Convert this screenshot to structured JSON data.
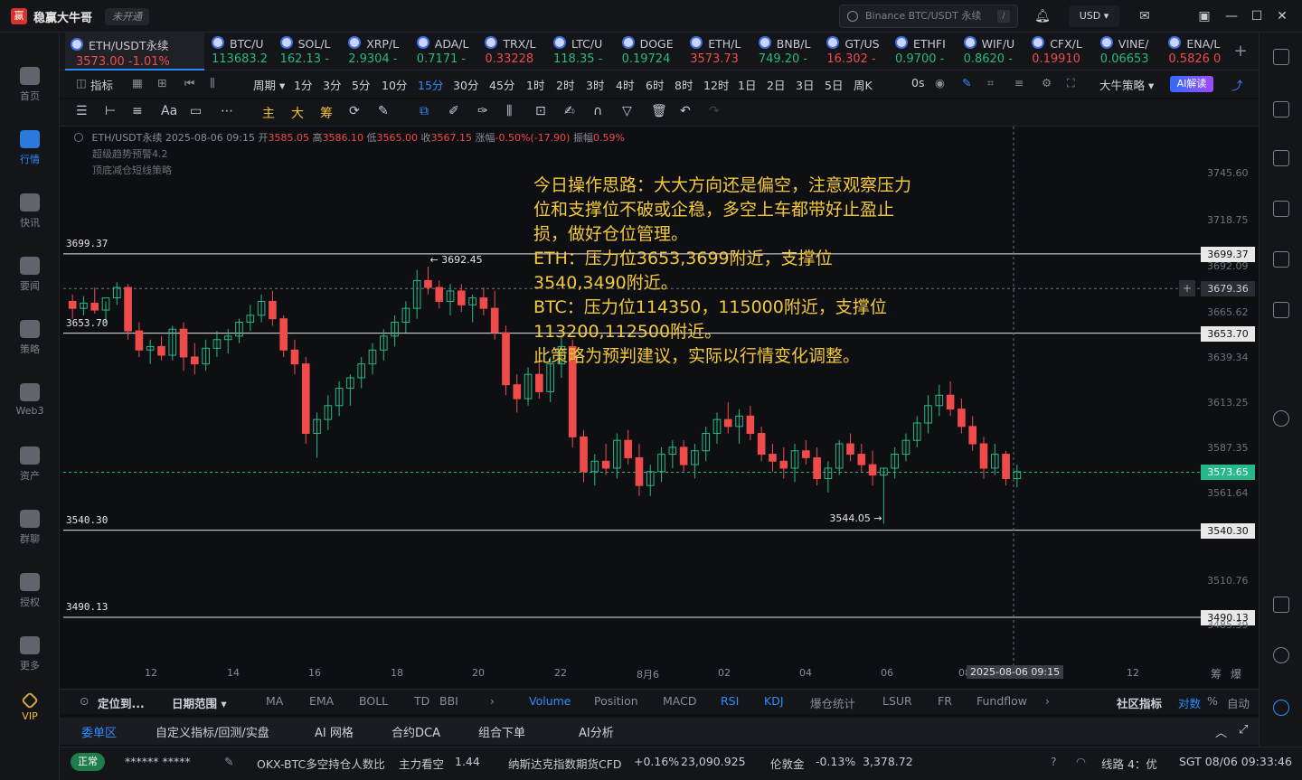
{
  "app": {
    "name": "稳赢大牛哥",
    "logo": "赢",
    "status": "未开通"
  },
  "search": {
    "placeholder": "Binance BTC/USDT 永续",
    "shortcut": "/"
  },
  "currency": "USD ▾",
  "sidebar": [
    {
      "label": "首页",
      "icon": "home-icon"
    },
    {
      "label": "行情",
      "icon": "market-chart-icon",
      "active": true
    },
    {
      "label": "快讯",
      "icon": "news-flash-icon"
    },
    {
      "label": "要闻",
      "icon": "headline-icon"
    },
    {
      "label": "策略",
      "icon": "strategy-robot-icon"
    },
    {
      "label": "Web3",
      "icon": "web3-icon"
    },
    {
      "label": "资产",
      "icon": "wallet-icon"
    },
    {
      "label": "群聊",
      "icon": "chat-icon"
    },
    {
      "label": "授权",
      "icon": "key-icon"
    },
    {
      "label": "更多",
      "icon": "grid-icon"
    },
    {
      "label": "VIP",
      "icon": "vip-diamond-icon"
    }
  ],
  "tickers": [
    {
      "name": "ETH/USDT永续",
      "price": "3573.00 -1.01%",
      "dir": "dn",
      "active": true
    },
    {
      "name": "BTC/U",
      "price": "113683.2",
      "dir": "up"
    },
    {
      "name": "SOL/L",
      "price": "162.13 -",
      "dir": "up"
    },
    {
      "name": "XRP/L",
      "price": "2.9304 -",
      "dir": "up"
    },
    {
      "name": "ADA/L",
      "price": "0.7171 -",
      "dir": "up"
    },
    {
      "name": "TRX/L",
      "price": "0.33228",
      "dir": "dn"
    },
    {
      "name": "LTC/U",
      "price": "118.35 -",
      "dir": "up"
    },
    {
      "name": "DOGE",
      "price": "0.19724",
      "dir": "up"
    },
    {
      "name": "ETH/L",
      "price": "3573.73",
      "dir": "dn"
    },
    {
      "name": "BNB/L",
      "price": "749.20 -",
      "dir": "up"
    },
    {
      "name": "GT/US",
      "price": "16.302 -",
      "dir": "dn"
    },
    {
      "name": "ETHFI",
      "price": "0.9700 -",
      "dir": "up"
    },
    {
      "name": "WIF/U",
      "price": "0.8620 -",
      "dir": "up"
    },
    {
      "name": "CFX/L",
      "price": "0.19910",
      "dir": "dn"
    },
    {
      "name": "VINE/",
      "price": "0.06653",
      "dir": "up"
    },
    {
      "name": "ENA/L",
      "price": "0.5826 0",
      "dir": "dn"
    }
  ],
  "periods": [
    "指标",
    "周期 ▾",
    "1分",
    "3分",
    "5分",
    "10分",
    "15分",
    "30分",
    "45分",
    "1时",
    "2时",
    "3时",
    "4时",
    "6时",
    "8时",
    "12时",
    "1日",
    "2日",
    "3日",
    "5日",
    "周K",
    "0s"
  ],
  "selected_period": "15分",
  "strategy_label": "大牛策略 ▾",
  "ai_label": "AI解读",
  "draw_tools": {
    "main": "主",
    "big": "大",
    "chips": "筹",
    "font": "Aa"
  },
  "chart": {
    "info": {
      "symbol": "ETH/USDT永续",
      "datetime": "2025-08-06 09:15",
      "open_label": "开",
      "open": "3585.05",
      "high_label": "高",
      "high": "3586.10",
      "low_label": "低",
      "low": "3565.00",
      "close_label": "收",
      "close": "3567.15",
      "change_label": "涨幅",
      "change": "-0.50%(-17.90)",
      "amp_label": "振幅",
      "amp": "0.59%"
    },
    "overlay_1": "超级趋势预警4.2",
    "overlay_2": "顶底减仓短线策略",
    "note": "今日操作思路：大大方向还是偏空，注意观察压力位和支撑位不破或企稳，多空上车都带好止盈止损，做好仓位管理。\nETH：压力位3653,3699附近，支撑位3540,3490附近。\nBTC：压力位114350，115000附近，支撑位113200,112500附近。\n此策略为预判建议，实际以行情变化调整。",
    "hlines": [
      "3699.37",
      "3653.70",
      "3540.30",
      "3490.13"
    ],
    "high_marker": "← 3692.45",
    "low_marker": "3544.05 →",
    "price_ticks": [
      "3745.60",
      "3718.75",
      "3692.09",
      "3665.62",
      "3639.34",
      "3613.25",
      "3587.35",
      "3561.64",
      "3510.76",
      "3485.39"
    ],
    "crosshair_price": "3679.36",
    "last_price": "3573.65",
    "x_ticks": [
      "12",
      "14",
      "16",
      "18",
      "20",
      "22",
      "8月6",
      "02",
      "04",
      "06",
      "08",
      "12"
    ],
    "crosshair_time": "2025-08-06 09:15",
    "corner_labels": [
      "筹",
      "爆"
    ]
  },
  "chart_data": {
    "type": "candlestick",
    "title": "ETH/USDT永续 15分",
    "ylim": [
      3470,
      3760
    ],
    "colors": {
      "up": "#26b88a",
      "down": "#f04b4b"
    },
    "candles": [
      [
        3672,
        3676,
        3662,
        3668
      ],
      [
        3668,
        3675,
        3664,
        3671
      ],
      [
        3671,
        3680,
        3665,
        3667
      ],
      [
        3667,
        3672,
        3660,
        3674
      ],
      [
        3674,
        3683,
        3670,
        3680
      ],
      [
        3680,
        3682,
        3650,
        3655
      ],
      [
        3655,
        3660,
        3640,
        3644
      ],
      [
        3644,
        3650,
        3636,
        3646
      ],
      [
        3646,
        3652,
        3638,
        3641
      ],
      [
        3641,
        3658,
        3638,
        3656
      ],
      [
        3656,
        3660,
        3632,
        3640
      ],
      [
        3640,
        3648,
        3630,
        3636
      ],
      [
        3636,
        3650,
        3632,
        3645
      ],
      [
        3645,
        3655,
        3640,
        3650
      ],
      [
        3650,
        3656,
        3642,
        3652
      ],
      [
        3652,
        3662,
        3648,
        3660
      ],
      [
        3660,
        3670,
        3655,
        3664
      ],
      [
        3664,
        3676,
        3660,
        3672
      ],
      [
        3672,
        3678,
        3658,
        3662
      ],
      [
        3662,
        3664,
        3640,
        3644
      ],
      [
        3644,
        3650,
        3630,
        3636
      ],
      [
        3636,
        3640,
        3590,
        3596
      ],
      [
        3596,
        3608,
        3582,
        3604
      ],
      [
        3604,
        3618,
        3598,
        3612
      ],
      [
        3612,
        3626,
        3606,
        3622
      ],
      [
        3622,
        3630,
        3612,
        3628
      ],
      [
        3628,
        3640,
        3622,
        3636
      ],
      [
        3636,
        3648,
        3630,
        3644
      ],
      [
        3644,
        3656,
        3638,
        3652
      ],
      [
        3652,
        3664,
        3646,
        3660
      ],
      [
        3660,
        3672,
        3654,
        3668
      ],
      [
        3668,
        3690,
        3662,
        3684
      ],
      [
        3684,
        3692,
        3676,
        3680
      ],
      [
        3680,
        3684,
        3668,
        3672
      ],
      [
        3672,
        3682,
        3664,
        3678
      ],
      [
        3678,
        3682,
        3666,
        3670
      ],
      [
        3670,
        3676,
        3660,
        3674
      ],
      [
        3674,
        3680,
        3664,
        3668
      ],
      [
        3668,
        3678,
        3650,
        3654
      ],
      [
        3654,
        3658,
        3618,
        3624
      ],
      [
        3624,
        3630,
        3608,
        3616
      ],
      [
        3616,
        3634,
        3612,
        3630
      ],
      [
        3630,
        3644,
        3616,
        3620
      ],
      [
        3620,
        3640,
        3614,
        3636
      ],
      [
        3636,
        3652,
        3628,
        3646
      ],
      [
        3646,
        3650,
        3588,
        3594
      ],
      [
        3594,
        3598,
        3568,
        3574
      ],
      [
        3574,
        3584,
        3566,
        3580
      ],
      [
        3580,
        3590,
        3572,
        3576
      ],
      [
        3576,
        3596,
        3570,
        3592
      ],
      [
        3592,
        3598,
        3578,
        3582
      ],
      [
        3582,
        3590,
        3560,
        3566
      ],
      [
        3566,
        3578,
        3560,
        3574
      ],
      [
        3574,
        3588,
        3568,
        3584
      ],
      [
        3584,
        3592,
        3576,
        3588
      ],
      [
        3588,
        3592,
        3574,
        3578
      ],
      [
        3578,
        3590,
        3570,
        3586
      ],
      [
        3586,
        3600,
        3580,
        3596
      ],
      [
        3596,
        3608,
        3590,
        3604
      ],
      [
        3604,
        3614,
        3596,
        3600
      ],
      [
        3600,
        3610,
        3590,
        3606
      ],
      [
        3606,
        3612,
        3592,
        3596
      ],
      [
        3596,
        3600,
        3580,
        3584
      ],
      [
        3584,
        3590,
        3574,
        3580
      ],
      [
        3580,
        3588,
        3570,
        3576
      ],
      [
        3576,
        3590,
        3568,
        3586
      ],
      [
        3586,
        3592,
        3578,
        3582
      ],
      [
        3582,
        3588,
        3566,
        3570
      ],
      [
        3570,
        3580,
        3562,
        3576
      ],
      [
        3576,
        3592,
        3572,
        3590
      ],
      [
        3590,
        3596,
        3580,
        3584
      ],
      [
        3584,
        3590,
        3574,
        3578
      ],
      [
        3578,
        3586,
        3566,
        3572
      ],
      [
        3572,
        3576,
        3544,
        3576
      ],
      [
        3576,
        3588,
        3570,
        3584
      ],
      [
        3584,
        3596,
        3580,
        3592
      ],
      [
        3592,
        3606,
        3588,
        3602
      ],
      [
        3602,
        3618,
        3596,
        3612
      ],
      [
        3612,
        3624,
        3606,
        3618
      ],
      [
        3618,
        3626,
        3606,
        3610
      ],
      [
        3610,
        3616,
        3596,
        3600
      ],
      [
        3600,
        3606,
        3586,
        3590
      ],
      [
        3590,
        3594,
        3570,
        3576
      ],
      [
        3576,
        3590,
        3572,
        3584
      ],
      [
        3584,
        3586,
        3566,
        3570
      ],
      [
        3570,
        3578,
        3565,
        3574
      ]
    ]
  },
  "indicators": [
    "定位到...",
    "日期范围 ▾",
    "MA",
    "EMA",
    "BOLL",
    "TD",
    "BBI",
    "Volume",
    "Position",
    "MACD",
    "RSI",
    "KDJ",
    "爆仓统计",
    "LSUR",
    "FR",
    "Fundflow",
    "社区指标",
    "对数",
    "%",
    "自动"
  ],
  "bottom_tabs": [
    "委单区",
    "自定义指标/回测/实盘",
    "AI 网格",
    "合约DCA",
    "组合下单",
    "AI分析"
  ],
  "statusbar": {
    "normal": "正常",
    "account": "******  *****",
    "ratio_label": "OKX-BTC多空持仓人数比",
    "ratio_state": "主力看空",
    "ratio_value": "1.44",
    "nasdaq_label": "纳斯达克指数期货CFD",
    "nasdaq_change": "+0.16%",
    "nasdaq_value": "23,090.925",
    "gold_label": "伦敦金",
    "gold_change": "-0.13%",
    "gold_value": "3,378.72",
    "line": "线路 4：优",
    "time": "SGT 08/06 09:33:46"
  }
}
